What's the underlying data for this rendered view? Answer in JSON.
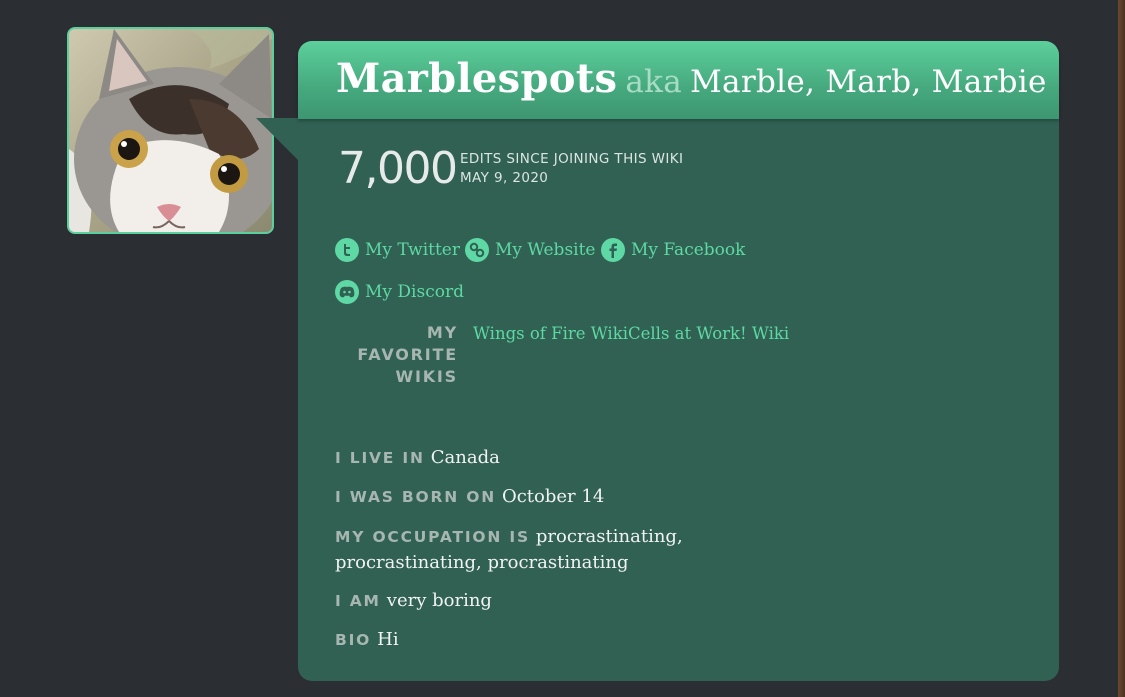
{
  "profile": {
    "username": "Marblespots",
    "aka_word": "aka",
    "aka_names": "Marble, Marb, Marbie",
    "edit_count": "7,000",
    "edit_label": "EDITS SINCE JOINING THIS WIKI",
    "join_date": "MAY 9, 2020"
  },
  "links": {
    "twitter": {
      "label": "My Twitter",
      "icon": "twitter-icon"
    },
    "website": {
      "label": "My Website",
      "icon": "link-icon"
    },
    "facebook": {
      "label": "My Facebook",
      "icon": "facebook-icon"
    },
    "discord": {
      "label": "My Discord",
      "icon": "discord-icon"
    }
  },
  "favorite_wikis": {
    "label_line1": "MY",
    "label_line2": "FAVORITE",
    "label_line3": "WIKIS",
    "items": [
      "Wings of Fire Wiki",
      "Cells at Work! Wiki"
    ]
  },
  "info": {
    "live_key": "I LIVE IN",
    "live_value": "Canada",
    "born_key": "I WAS BORN ON",
    "born_value": "October 14",
    "occupation_key": "MY OCCUPATION IS",
    "occupation_value": "procrastinating, procrastinating, procrastinating",
    "iam_key": "I AM",
    "iam_value": "very boring",
    "bio_key": "BIO",
    "bio_value": "Hi"
  },
  "colors": {
    "page_bg": "#2b2e33",
    "card_bg": "#316153",
    "header_gradient_top": "#5cd09c",
    "link_color": "#5ed8a4",
    "label_grey": "#a7b6b0"
  }
}
